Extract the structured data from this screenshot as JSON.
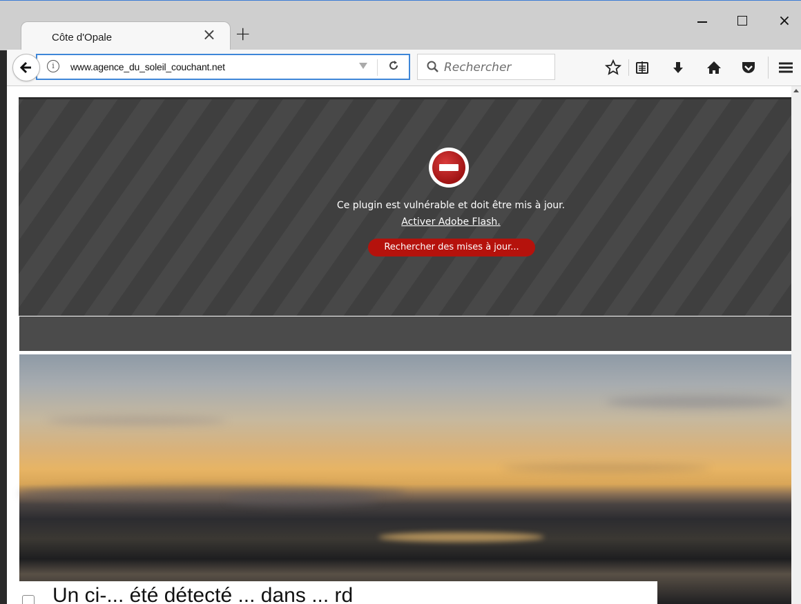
{
  "window": {
    "tab_title": "Côte d'Opale",
    "tab_close": "×",
    "new_tab": "+",
    "close_glyph": "×"
  },
  "navbar": {
    "url": "www.agence_du_soleil_couchant.net",
    "search_placeholder": "Rechercher",
    "reload_glyph": "C"
  },
  "plugin": {
    "message": "Ce plugin est vulnérable et doit être mis à jour.",
    "activate_link": "Activer Adobe Flash.",
    "update_button": "Rechercher des mises à jour..."
  },
  "notice": {
    "text": "Un ci-... été détecté ... dans ... rd"
  },
  "colors": {
    "accent": "#3d86d8",
    "update_button": "#b5120c",
    "plugin_bg": "#3f3f3f"
  },
  "icons": [
    "back-arrow-icon",
    "info-icon",
    "dropdown-icon",
    "reload-icon",
    "search-icon",
    "bookmark-star-icon",
    "reading-list-icon",
    "download-icon",
    "home-icon",
    "pocket-icon",
    "hamburger-menu-icon",
    "plugin-blocked-icon"
  ]
}
